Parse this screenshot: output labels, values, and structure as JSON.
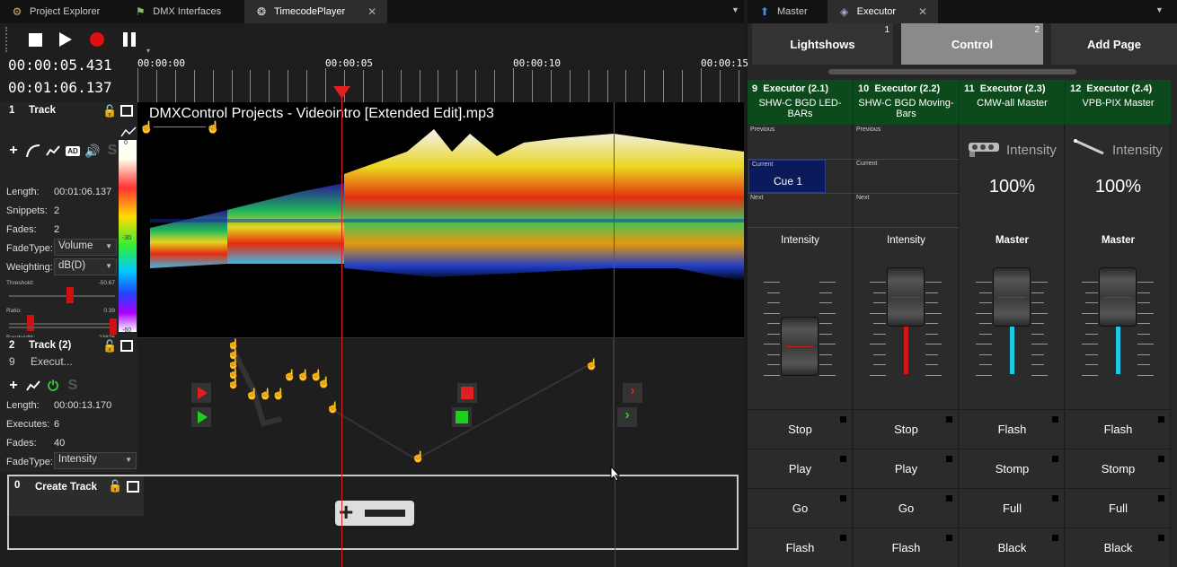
{
  "left_tabs": [
    {
      "label": "Project Explorer",
      "icon": "gears-icon"
    },
    {
      "label": "DMX Interfaces",
      "icon": "plug-icon"
    },
    {
      "label": "TimecodePlayer",
      "icon": "reel-icon",
      "active": true,
      "close": "✕"
    }
  ],
  "right_tabs": [
    {
      "label": "Master",
      "icon": "arrow-up-icon"
    },
    {
      "label": "Executor",
      "icon": "cube-icon",
      "active": true,
      "close": "✕"
    }
  ],
  "transport": {
    "current_time": "00:00:05.431",
    "total_time": "00:01:06.137"
  },
  "ruler": {
    "labels": [
      "00:00:00",
      "00:00:05",
      "00:00:10",
      "00:00:15"
    ]
  },
  "track1": {
    "number": "1",
    "name": "Track",
    "file_title": "DMXControl Projects - Videointro [Extended Edit].mp3",
    "length_label": "Length:",
    "length_value": "00:01:06.137",
    "snippets_label": "Snippets:",
    "snippets_value": "2",
    "fades_label": "Fades:",
    "fades_value": "2",
    "fadetype_label": "FadeType:",
    "fadetype_value": "Volume",
    "weighting_label": "Weighting:",
    "weighting_value": "dB(D)",
    "threshold_label": "Threshold:",
    "threshold_value": "-50.67",
    "ratio_label": "Ratio:",
    "ratio_value": "0.39",
    "bandwidth_label": "Bandwidth:",
    "bandwidth_value": "23826",
    "scale_top": "0",
    "scale_mid": "-30",
    "scale_bot": "-60"
  },
  "track2": {
    "number": "2",
    "name": "Track (2)",
    "sub_number": "9",
    "sub_name": "Execut...",
    "length_label": "Length:",
    "length_value": "00:00:13.170",
    "executes_label": "Executes:",
    "executes_value": "6",
    "fades_label": "Fades:",
    "fades_value": "40",
    "fadetype_label": "FadeType:",
    "fadetype_value": "Intensity"
  },
  "create_track": {
    "number": "0",
    "name": "Create Track"
  },
  "pages": [
    {
      "label": "Lightshows",
      "num": "1"
    },
    {
      "label": "Control",
      "num": "2",
      "active": true
    },
    {
      "label": "Add Page",
      "num": ""
    }
  ],
  "cue_labels": {
    "previous": "Previous",
    "current": "Current",
    "next": "Next"
  },
  "executors": [
    {
      "number": "9",
      "name": "Executor (2.1)",
      "desc": "SHW-C BGD LED-BARs",
      "type": "cue",
      "current_cue": "Cue 1",
      "fader_label": "Intensity",
      "level": 0.3,
      "track_color": "#d01818",
      "buttons": [
        "Stop",
        "Play",
        "Go",
        "Flash"
      ]
    },
    {
      "number": "10",
      "name": "Executor (2.2)",
      "desc": "SHW-C BGD Moving-Bars",
      "type": "cue",
      "current_cue": "",
      "fader_label": "Intensity",
      "level": 0.83,
      "track_color": "#d01818",
      "buttons": [
        "Stop",
        "Play",
        "Go",
        "Flash"
      ]
    },
    {
      "number": "11",
      "name": "Executor (2.3)",
      "desc": "CMW-all Master",
      "type": "master",
      "intensity_label": "Intensity",
      "intensity_value": "100%",
      "fader_label": "Master",
      "level": 0.83,
      "track_color": "#1ec8e6",
      "buttons": [
        "Flash",
        "Stomp",
        "Full",
        "Black"
      ]
    },
    {
      "number": "12",
      "name": "Executor (2.4)",
      "desc": "VPB-PIX Master",
      "type": "master",
      "intensity_label": "Intensity",
      "intensity_value": "100%",
      "fader_label": "Master",
      "level": 0.83,
      "track_color": "#1ec8e6",
      "buttons": [
        "Flash",
        "Stomp",
        "Full",
        "Black"
      ]
    }
  ]
}
